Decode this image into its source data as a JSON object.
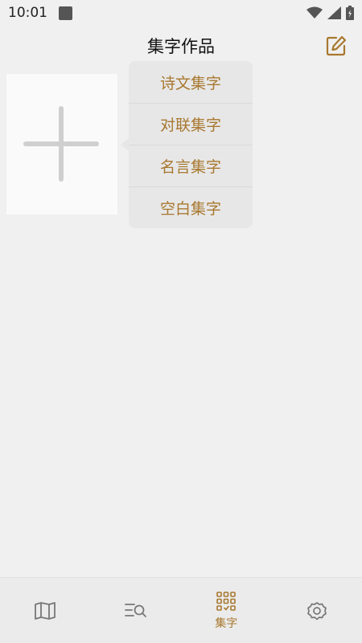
{
  "status_bar": {
    "time": "10:01",
    "icons": [
      "notification-square-icon",
      "wifi-icon",
      "signal-icon",
      "battery-icon"
    ]
  },
  "header": {
    "title": "集字作品",
    "edit_icon": "edit-icon"
  },
  "add_tile": {
    "icon": "plus-icon"
  },
  "popup_menu": {
    "items": [
      {
        "label": "诗文集字"
      },
      {
        "label": "对联集字"
      },
      {
        "label": "名言集字"
      },
      {
        "label": "空白集字"
      }
    ]
  },
  "bottom_nav": {
    "items": [
      {
        "icon": "map-icon",
        "label": ""
      },
      {
        "icon": "search-list-icon",
        "label": ""
      },
      {
        "icon": "grid-icon",
        "label": "集字",
        "active": true
      },
      {
        "icon": "settings-icon",
        "label": ""
      }
    ]
  },
  "colors": {
    "accent": "#a8782f",
    "background": "#f0f0f0",
    "menu_background": "#e7e7e7",
    "icon_gray": "#777777"
  }
}
